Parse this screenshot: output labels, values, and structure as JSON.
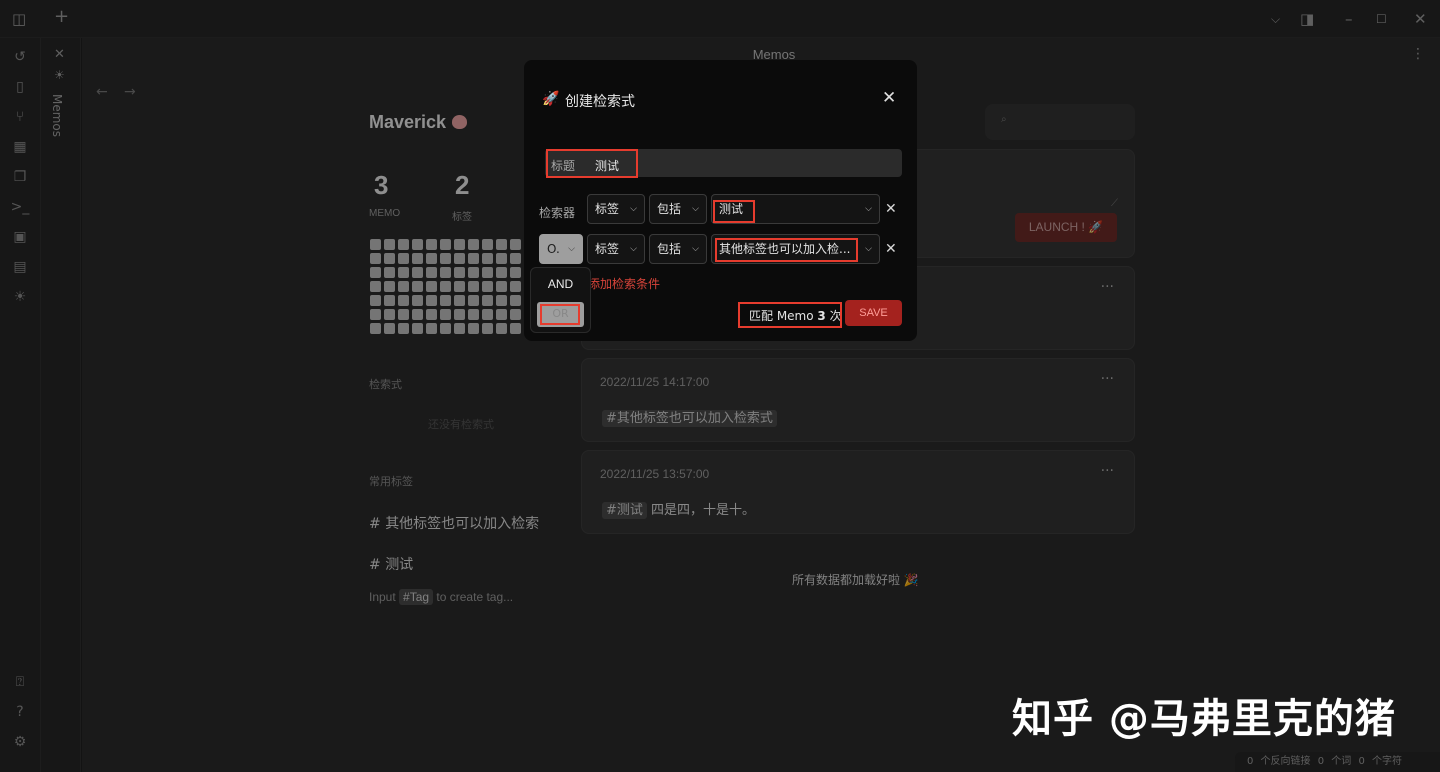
{
  "app": {
    "view_title": "Memos",
    "sidebar_vertical_label": "Memos"
  },
  "user": {
    "name": "Maverick",
    "stats": [
      {
        "value": "3",
        "label": "MEMO"
      },
      {
        "value": "2",
        "label": "标签"
      }
    ]
  },
  "sidebar_sections": {
    "queries_title": "检索式",
    "queries_placeholder": "还没有检索式",
    "tags_title": "常用标签",
    "tags": [
      {
        "hash": "#",
        "label": "其他标签也可以加入检索"
      },
      {
        "hash": "#",
        "label": "测试"
      }
    ],
    "input_hint_prefix": "Input",
    "input_hint_chip": "#Tag",
    "input_hint_suffix": "to create tag..."
  },
  "editor": {
    "launch_label": "LAUNCH ! 🚀"
  },
  "memos": [
    {
      "time": "2022/11/25 14:17:00",
      "tag": "#其他标签也可以加入检索式",
      "text": ""
    },
    {
      "time": "2022/11/25 13:57:00",
      "tag": "#测试",
      "text": "四是四，十是十。"
    }
  ],
  "feed_footer": "所有数据都加载好啦 🎉",
  "statusbar": {
    "backlinks": "0 个反向链接",
    "words": "0 个词",
    "chars": "0 个字符"
  },
  "watermark": "知乎 @马弗里克的猪",
  "modal": {
    "title": "创建检索式",
    "title_field_label": "标题",
    "title_field_value": "测试",
    "filter_label": "检索器",
    "rows": [
      {
        "op": "",
        "field": "标签",
        "cond": "包括",
        "value": "测试"
      },
      {
        "op": "O.",
        "field": "标签",
        "cond": "包括",
        "value": "其他标签也可以加入检..."
      }
    ],
    "add_condition": "添加检索条件",
    "match_text_prefix": "匹配 Memo",
    "match_count": "3",
    "match_text_suffix": "次",
    "save_label": "SAVE"
  },
  "operator_dropdown": {
    "options": [
      "AND",
      "OR"
    ],
    "selected": "OR"
  },
  "colors": {
    "accent": "#e63c2e",
    "save_bg": "#a4221e",
    "modal_bg": "#0b0b0b"
  },
  "icons": {
    "ribbon": [
      "history-icon",
      "file-icon",
      "graph-icon",
      "calendar-icon",
      "copy-icon",
      "terminal-icon",
      "image-icon",
      "layout-icon",
      "bulb-icon",
      "vault-icon",
      "help-icon",
      "settings-icon"
    ]
  }
}
